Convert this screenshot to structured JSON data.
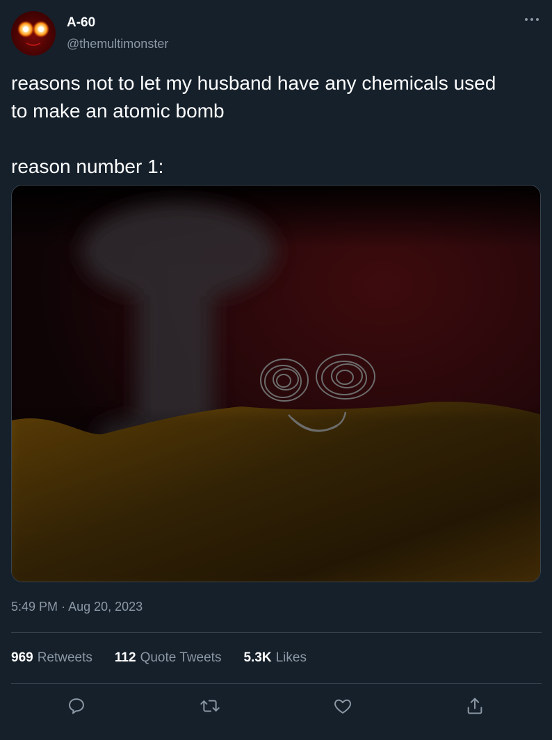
{
  "author": {
    "name": "A-60",
    "handle": "@themultimonster",
    "avatar_icon": "red-glowing-eyes-monster-avatar"
  },
  "menu": {
    "icon": "more-icon"
  },
  "tweet": {
    "text_lines": [
      "reasons not to let my husband have any chemicals used",
      "to make an atomic bomb",
      "reason number 1:"
    ]
  },
  "media": {
    "description_icon": "attached-drawing-image"
  },
  "meta": {
    "time": "5:49 PM",
    "separator": "·",
    "date": "Aug 20, 2023"
  },
  "stats": {
    "retweets": {
      "count": "969",
      "label": "Retweets"
    },
    "quotes": {
      "count": "112",
      "label": "Quote Tweets"
    },
    "likes": {
      "count": "5.3K",
      "label": "Likes"
    }
  },
  "actions": {
    "reply_icon": "reply-icon",
    "retweet_icon": "retweet-icon",
    "like_icon": "heart-icon",
    "share_icon": "share-icon"
  },
  "colors": {
    "background": "#15202b",
    "text_secondary": "#8b98a5",
    "border": "#38444d",
    "sand": "#6b4a0a",
    "sky_red": "#3a0808"
  }
}
